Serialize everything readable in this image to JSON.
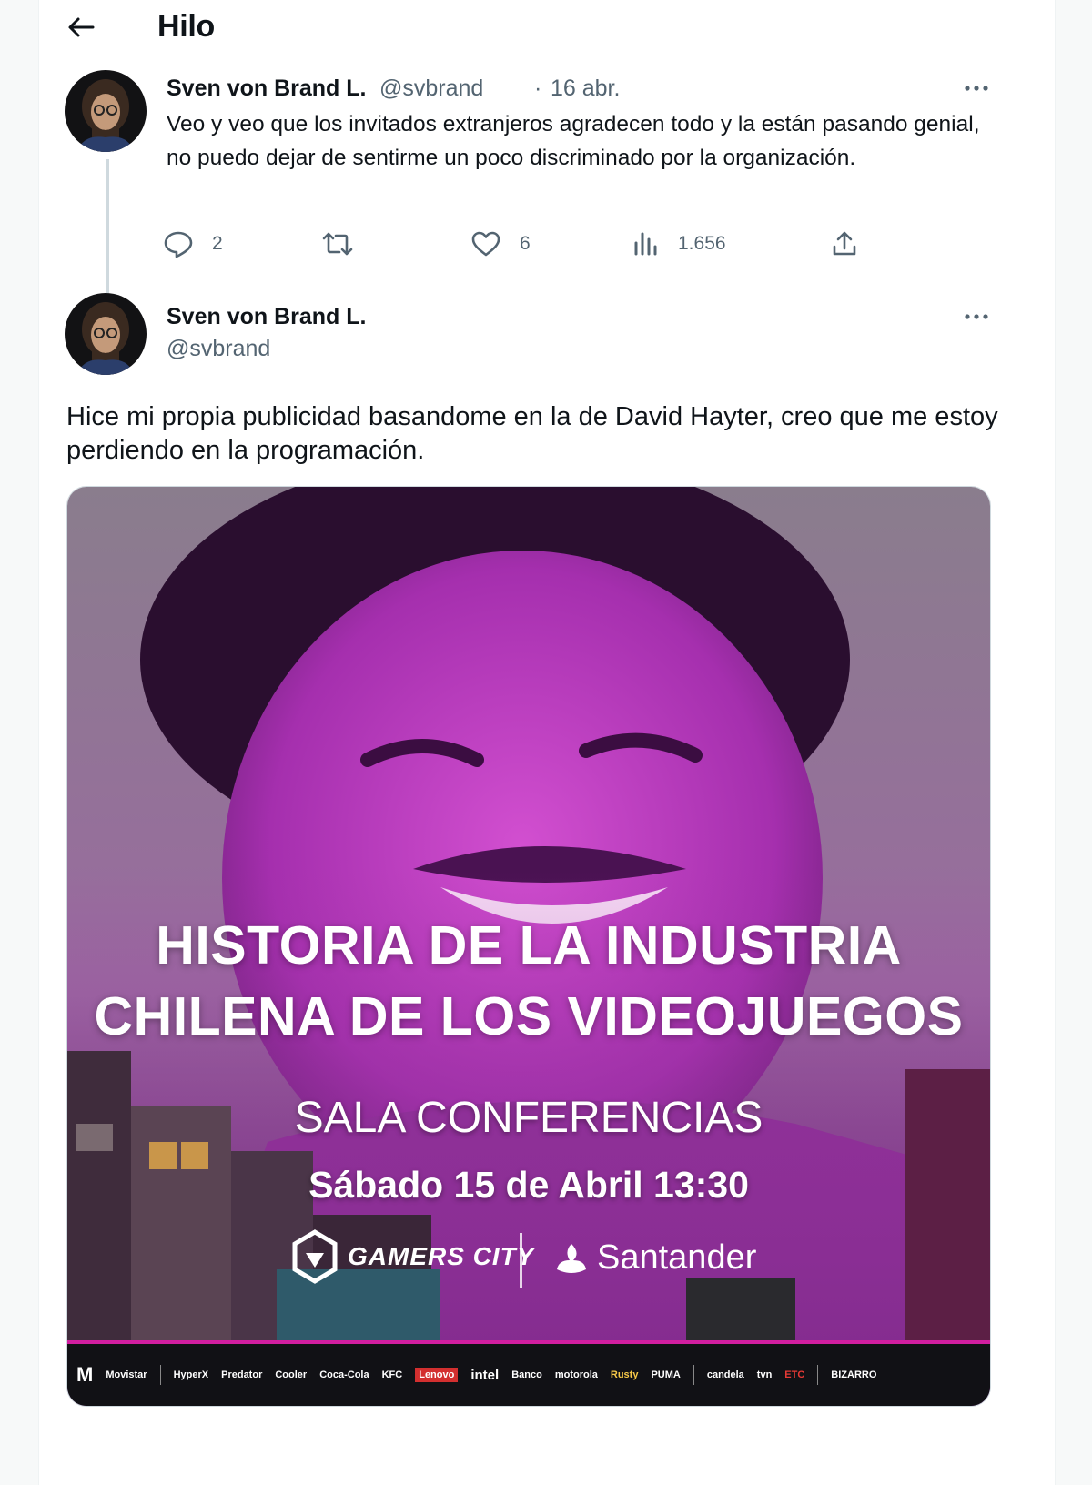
{
  "header": {
    "title": "Hilo"
  },
  "tweet1": {
    "name": "Sven von Brand L.",
    "handle": "@svbrand",
    "separator": "·",
    "date": "16 abr.",
    "text": "Veo y veo que los invitados extranjeros agradecen todo y la están pasando genial, no puedo dejar de sentirme un poco discriminado por la organización.",
    "actions": {
      "replies": "2",
      "likes": "6",
      "views": "1.656"
    }
  },
  "tweet2": {
    "name": "Sven von Brand L.",
    "handle": "@svbrand",
    "text": "Hice mi propia publicidad basandome en la de David Hayter, creo que me estoy perdiendo en la programación.",
    "poster": {
      "title_line1": "HISTORIA DE LA INDUSTRIA",
      "title_line2": "CHILENA DE LOS VIDEOJUEGOS",
      "venue": "SALA CONFERENCIAS",
      "datetime": "Sábado 15 de Abril 13:30",
      "logo_gamers": "GAMERS CITY",
      "logo_santander": "Santander",
      "sponsors": [
        "Movistar",
        "HyperX",
        "Predator",
        "Cooler",
        "Coca-Cola",
        "KFC",
        "Lenovo",
        "intel",
        "Banco",
        "motorola",
        "Rusty",
        "PUMA",
        "candela",
        "tvn",
        "ETC",
        "BIZARRO"
      ]
    }
  },
  "colors": {
    "accent": "#1d9bf0",
    "muted": "#536471",
    "poster_magenta": "#b23bb5"
  }
}
